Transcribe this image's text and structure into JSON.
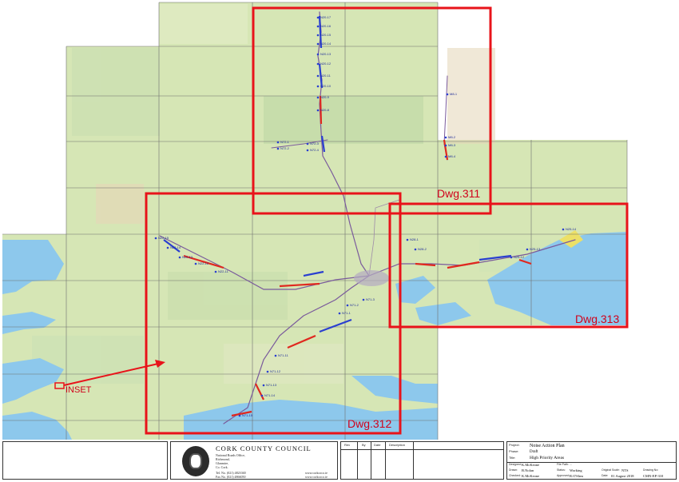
{
  "map": {
    "drawing_labels": {
      "dwg311": "Dwg.311",
      "dwg312": "Dwg.312",
      "dwg313": "Dwg.313"
    },
    "inset_label": "INSET",
    "colors": {
      "frame": "#e8131a",
      "water": "#8ec9ec",
      "land": "#d7e7b8",
      "grid": "#6b6b6b",
      "route_blue": "#2a3fd0",
      "route_red": "#e0281f",
      "route_orange": "#f08a1c"
    },
    "location_tags": [
      "N20-17",
      "N20-16",
      "N20-15",
      "N20-14",
      "N20-13",
      "N20-12",
      "N20-11",
      "N20-10",
      "N20-9",
      "N20-8",
      "N72-1",
      "N72-2",
      "N72-3",
      "N72-4",
      "M8-1",
      "M8-2",
      "M8-3",
      "M8-4",
      "N22-15",
      "N22-14",
      "N22-13",
      "N22-12",
      "N22-11",
      "N71-1",
      "N71-2",
      "N71-3",
      "N71-11",
      "N71-12",
      "N71-13",
      "N71-14",
      "N71-15",
      "N25-14",
      "N25-13",
      "N25-12",
      "N28-1",
      "N28-2"
    ]
  },
  "titleblock": {
    "council": "CORK COUNTY COUNCIL",
    "address": [
      "National Roads Office,",
      "Richmond,",
      "Glanmire,",
      "Co. Cork."
    ],
    "tel": "Tel. No. (021) 4821040",
    "fax": "Fax No. (021) 4866050",
    "web": [
      "www.corkcoco.ie",
      "www.corkcoco.ie"
    ],
    "rev_headers": [
      "Rev",
      "By",
      "Date",
      "Description"
    ],
    "project_key": "Project:",
    "project": "Noise Action Plan",
    "phase_key": "Phase:",
    "phase": "Draft",
    "title_key": "Title:",
    "title": "High Priority Areas",
    "designer_key": "Designed:",
    "designer": "K.McKeone",
    "drawn_key": "Drawn:",
    "drawn": "B.Nolan",
    "checked_key": "Checked:",
    "checked": "K.McKeone",
    "filepath_key": "File Path:",
    "filepath": "...",
    "status_key": "Status:",
    "status": "Working",
    "approved_key": "Approved:",
    "approved": "R.O'Shea",
    "scale_key": "Original Scale:",
    "scale": "NTS",
    "date_key": "Date:",
    "date": "01 August 2018",
    "drawing_no_key": "Drawing No:",
    "drawing_no": "CMN-EP-310"
  }
}
